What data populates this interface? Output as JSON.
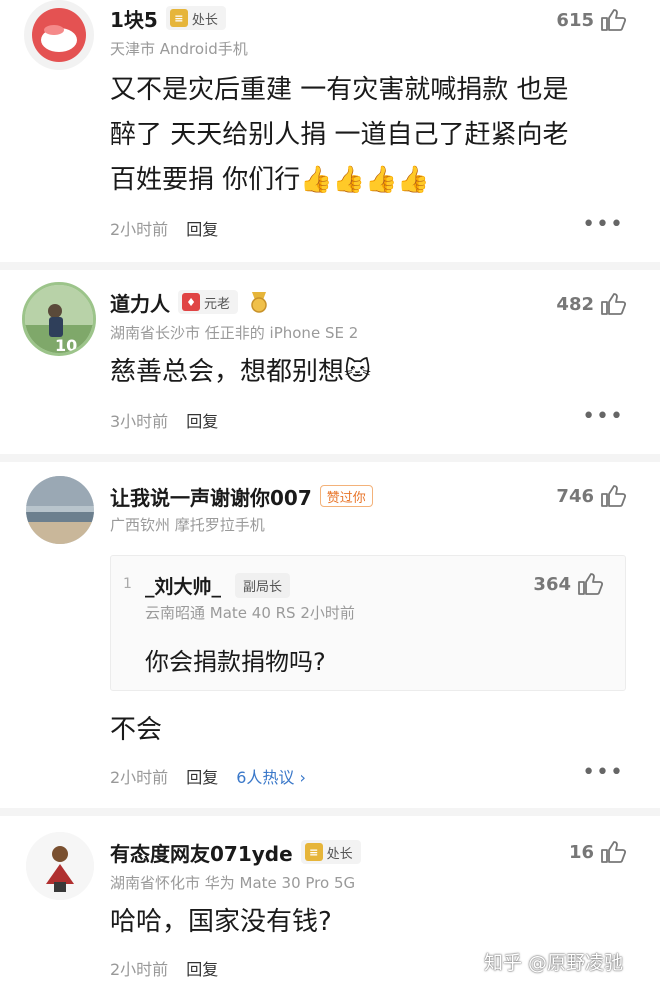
{
  "comments": [
    {
      "name": "1块5",
      "badge": "处长",
      "meta": "天津市  Android手机",
      "likes": "615",
      "text_lines": [
        "又不是灾后重建 一有灾害就喊捐款 也是",
        "醉了 天天给别人捐 一道自己了赶紧向老",
        "百姓要捐 你们行👍👍👍👍"
      ],
      "time": "2小时前",
      "reply": "回复"
    },
    {
      "name": "道力人",
      "badge": "元老",
      "meta": "湖南省长沙市  任正非的 iPhone SE 2",
      "likes": "482",
      "text_lines": [
        "慈善总会，想都别想🐱"
      ],
      "time": "3小时前",
      "reply": "回复"
    },
    {
      "name": "让我说一声谢谢你007",
      "badge": "赞过你",
      "meta": "广西钦州  摩托罗拉手机",
      "likes": "746",
      "quote": {
        "index": "1",
        "name": "_刘大帅_",
        "badge": "副局长",
        "meta": "云南昭通  Mate 40 RS  2小时前",
        "likes": "364",
        "text": "你会捐款捐物吗?"
      },
      "text_lines": [
        "不会"
      ],
      "time": "2小时前",
      "reply": "回复",
      "hot": "6人热议 ›"
    },
    {
      "name": "有态度网友071yde",
      "badge": "处长",
      "meta": "湖南省怀化市  华为 Mate 30 Pro 5G",
      "likes": "16",
      "text_lines": [
        "哈哈，国家没有钱?"
      ],
      "time": "2小时前",
      "reply": "回复"
    }
  ],
  "watermark": "知乎 @原野凌驰",
  "colors": {
    "link": "#3a78c9",
    "divider": "#f4f4f4",
    "gold_badge": "#e6b53a",
    "red_badge": "#e04444"
  }
}
